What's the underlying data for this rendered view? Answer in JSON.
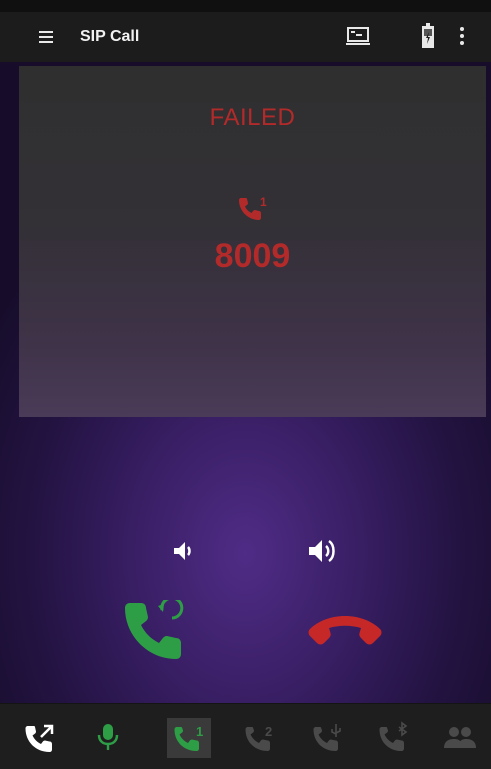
{
  "toolbar": {
    "title": "SIP Call",
    "icons": [
      "menu-icon",
      "screen-icon",
      "battery-icon",
      "more-vert-icon"
    ]
  },
  "call": {
    "status": "FAILED",
    "line": "1",
    "number": "8009"
  },
  "controls": {
    "volume_down": "volume-down-icon",
    "volume_up": "volume-up-icon",
    "redial": "redial-icon",
    "hangup": "hangup-icon"
  },
  "bottom_bar": {
    "items": [
      {
        "icon": "call-transfer-icon",
        "label": ""
      },
      {
        "icon": "microphone-icon",
        "label": ""
      },
      {
        "icon": "line-1-icon",
        "label": "1"
      },
      {
        "icon": "line-2-icon",
        "label": "2"
      },
      {
        "icon": "usb-line-icon",
        "label": ""
      },
      {
        "icon": "bluetooth-line-icon",
        "label": ""
      },
      {
        "icon": "contacts-icon",
        "label": ""
      }
    ]
  },
  "colors": {
    "failed_red": "#b32a2a",
    "hangup_red": "#c62828",
    "redial_green": "#2e9e46",
    "mic_green": "#2e9e46",
    "active_line_green": "#2e9e46",
    "inactive_icon": "#4a4a4a"
  }
}
